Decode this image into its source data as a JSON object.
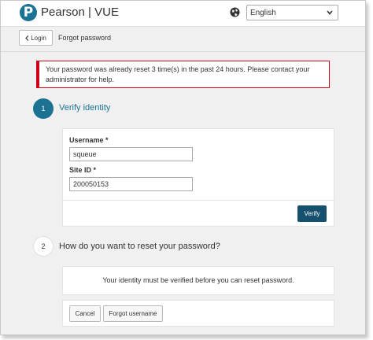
{
  "header": {
    "logo_letter": "P",
    "brand": "Pearson | VUE",
    "language_icon": "globe-icon",
    "language": "English",
    "language_chevron_icon": "chevron-down-icon"
  },
  "subbar": {
    "back_icon": "chevron-left-icon",
    "back_label": "Login",
    "title": "Forgot password"
  },
  "alert": {
    "text": "Your password was already reset 3 time(s) in the past 24 hours. Please contact your administrator for help.",
    "color": "#d0021b"
  },
  "step1": {
    "number": "1",
    "title": "Verify identity",
    "username_label": "Username *",
    "username_value": "squeue",
    "site_id_label": "Site ID *",
    "site_id_value": "200050153",
    "verify_label": "Verify"
  },
  "step2": {
    "number": "2",
    "title": "How do you want to reset your password?",
    "message": "Your identity must be verified before you can reset password.",
    "cancel_label": "Cancel",
    "forgot_username_label": "Forgot username"
  },
  "colors": {
    "accent": "#1c7293",
    "button_dark": "#174f6e",
    "background": "#f0f0f0"
  }
}
